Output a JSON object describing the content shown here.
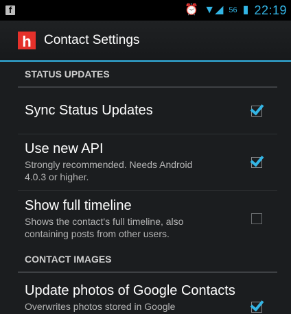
{
  "status_bar": {
    "left_icon": "facebook-notification-icon",
    "signal_label": "56",
    "time": "22:19"
  },
  "action_bar": {
    "logo_letter": "h",
    "title": "Contact Settings"
  },
  "sections": [
    {
      "header": "STATUS UPDATES",
      "items": [
        {
          "title": "Sync Status Updates",
          "summary": "",
          "checked": true
        },
        {
          "title": "Use new API",
          "summary_line1": "Strongly recommended. Needs Android",
          "summary_line2": "4.0.3 or higher.",
          "checked": true
        },
        {
          "title": "Show full timeline",
          "summary_line1": "Shows the contact's full timeline, also",
          "summary_line2": "containing posts from other users.",
          "checked": false
        }
      ]
    },
    {
      "header": "CONTACT IMAGES",
      "items": [
        {
          "title": "Update photos of Google Contacts",
          "summary_line1": "Overwrites photos stored in Google",
          "checked": true
        }
      ]
    }
  ]
}
